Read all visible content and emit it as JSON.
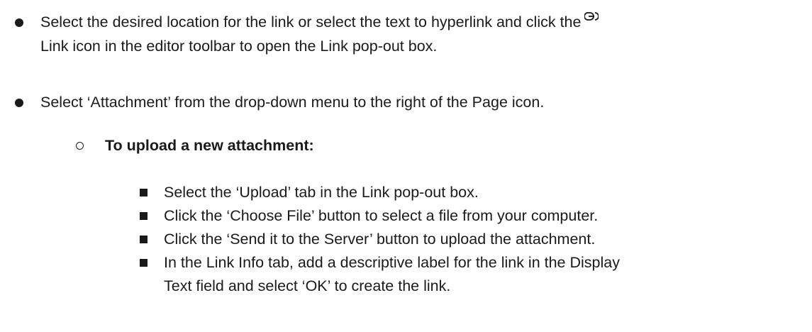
{
  "bullets": [
    {
      "line1_before_icon": "Select the desired location for the link or select the text to hyperlink and click the",
      "link_icon": "link-icon",
      "line2": "Link icon in the editor toolbar to open the Link pop-out box."
    },
    {
      "text": "Select ‘Attachment’ from the drop-down menu to the right of the Page icon."
    }
  ],
  "subsection": {
    "heading": "To upload a new attachment:",
    "steps": [
      "Select the ‘Upload’ tab in the Link pop-out box.",
      "Click the ‘Choose File’ button to select a file from your computer.",
      "Click the ‘Send it to the Server’ button to upload the attachment.",
      "In the Link Info tab, add a descriptive label for the link in the Display",
      "Text field and select ‘OK’ to create the link."
    ]
  }
}
